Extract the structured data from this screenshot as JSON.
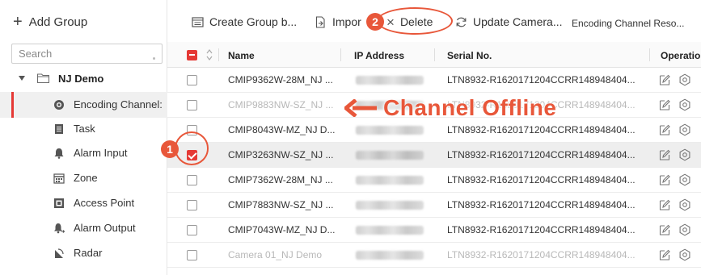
{
  "left_panel": {
    "add_group": "Add Group",
    "search_placeholder": "Search",
    "group": {
      "name": "NJ Demo"
    },
    "items": [
      {
        "label": "Encoding Channel:",
        "icon": "encoding-channel-icon",
        "active": true
      },
      {
        "label": "Task",
        "icon": "task-icon"
      },
      {
        "label": "Alarm Input",
        "icon": "alarm-input-icon"
      },
      {
        "label": "Zone",
        "icon": "zone-icon"
      },
      {
        "label": "Access Point",
        "icon": "access-point-icon"
      },
      {
        "label": "Alarm Output",
        "icon": "alarm-output-icon"
      },
      {
        "label": "Radar",
        "icon": "radar-icon"
      }
    ]
  },
  "toolbar": {
    "create_group": "Create Group b...",
    "import": "Impor",
    "delete": "Delete",
    "update_camera": "Update Camera...",
    "encoding_channel_reso": "Encoding Channel Reso..."
  },
  "annotations": {
    "step1": "1",
    "step2": "2",
    "offline_label": "Channel Offline",
    "accent": "#e8573a"
  },
  "table": {
    "headers": {
      "name": "Name",
      "ip": "IP Address",
      "serial": "Serial No.",
      "operation": "Operation"
    },
    "rows": [
      {
        "name": "CMIP9362W-28M_NJ ...",
        "serial": "LTN8932-R1620171204CCRR148948404...",
        "checked": false,
        "offline": false
      },
      {
        "name": "CMIP9883NW-SZ_NJ ...",
        "serial": "LTN8932-R1620171204CCRR148948404...",
        "checked": false,
        "offline": true
      },
      {
        "name": "CMIP8043W-MZ_NJ D...",
        "serial": "LTN8932-R1620171204CCRR148948404...",
        "checked": false,
        "offline": false
      },
      {
        "name": "CMIP3263NW-SZ_NJ ...",
        "serial": "LTN8932-R1620171204CCRR148948404...",
        "checked": true,
        "offline": false
      },
      {
        "name": "CMIP7362W-28M_NJ ...",
        "serial": "LTN8932-R1620171204CCRR148948404...",
        "checked": false,
        "offline": false
      },
      {
        "name": "CMIP7883NW-SZ_NJ ...",
        "serial": "LTN8932-R1620171204CCRR148948404...",
        "checked": false,
        "offline": false
      },
      {
        "name": "CMIP7043W-MZ_NJ D...",
        "serial": "LTN8932-R1620171204CCRR148948404...",
        "checked": false,
        "offline": false
      },
      {
        "name": "Camera 01_NJ Demo",
        "serial": "LTN8932-R1620171204CCRR148948404...",
        "checked": false,
        "offline": true
      }
    ]
  }
}
